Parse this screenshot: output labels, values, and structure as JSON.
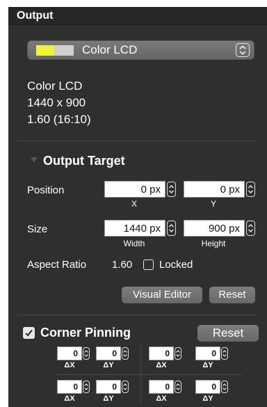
{
  "panel": {
    "title": "Output"
  },
  "display": {
    "selected": "Color LCD",
    "swatch_colors": [
      "#f2f23a",
      "#cfcfcf"
    ],
    "info": {
      "name": "Color LCD",
      "resolution": "1440 x 900",
      "scale": "1.60 (16:10)"
    }
  },
  "output_target": {
    "title": "Output Target",
    "position": {
      "label": "Position",
      "x_value": "0 px",
      "y_value": "0 px",
      "x_caption": "X",
      "y_caption": "Y"
    },
    "size": {
      "label": "Size",
      "width_value": "1440 px",
      "height_value": "900 px",
      "width_caption": "Width",
      "height_caption": "Height"
    },
    "aspect": {
      "label": "Aspect Ratio",
      "value": "1.60",
      "locked_label": "Locked",
      "locked": false
    },
    "visual_editor_label": "Visual Editor",
    "reset_label": "Reset"
  },
  "corner_pinning": {
    "label": "Corner Pinning",
    "checked": true,
    "reset_label": "Reset",
    "fields": [
      {
        "value": "0",
        "caption": "ΔX"
      },
      {
        "value": "0",
        "caption": "ΔY"
      },
      {
        "value": "0",
        "caption": "ΔX"
      },
      {
        "value": "0",
        "caption": "ΔY"
      },
      {
        "value": "0",
        "caption": "ΔX"
      },
      {
        "value": "0",
        "caption": "ΔY"
      },
      {
        "value": "0",
        "caption": "ΔX"
      },
      {
        "value": "0",
        "caption": "ΔY"
      }
    ]
  }
}
